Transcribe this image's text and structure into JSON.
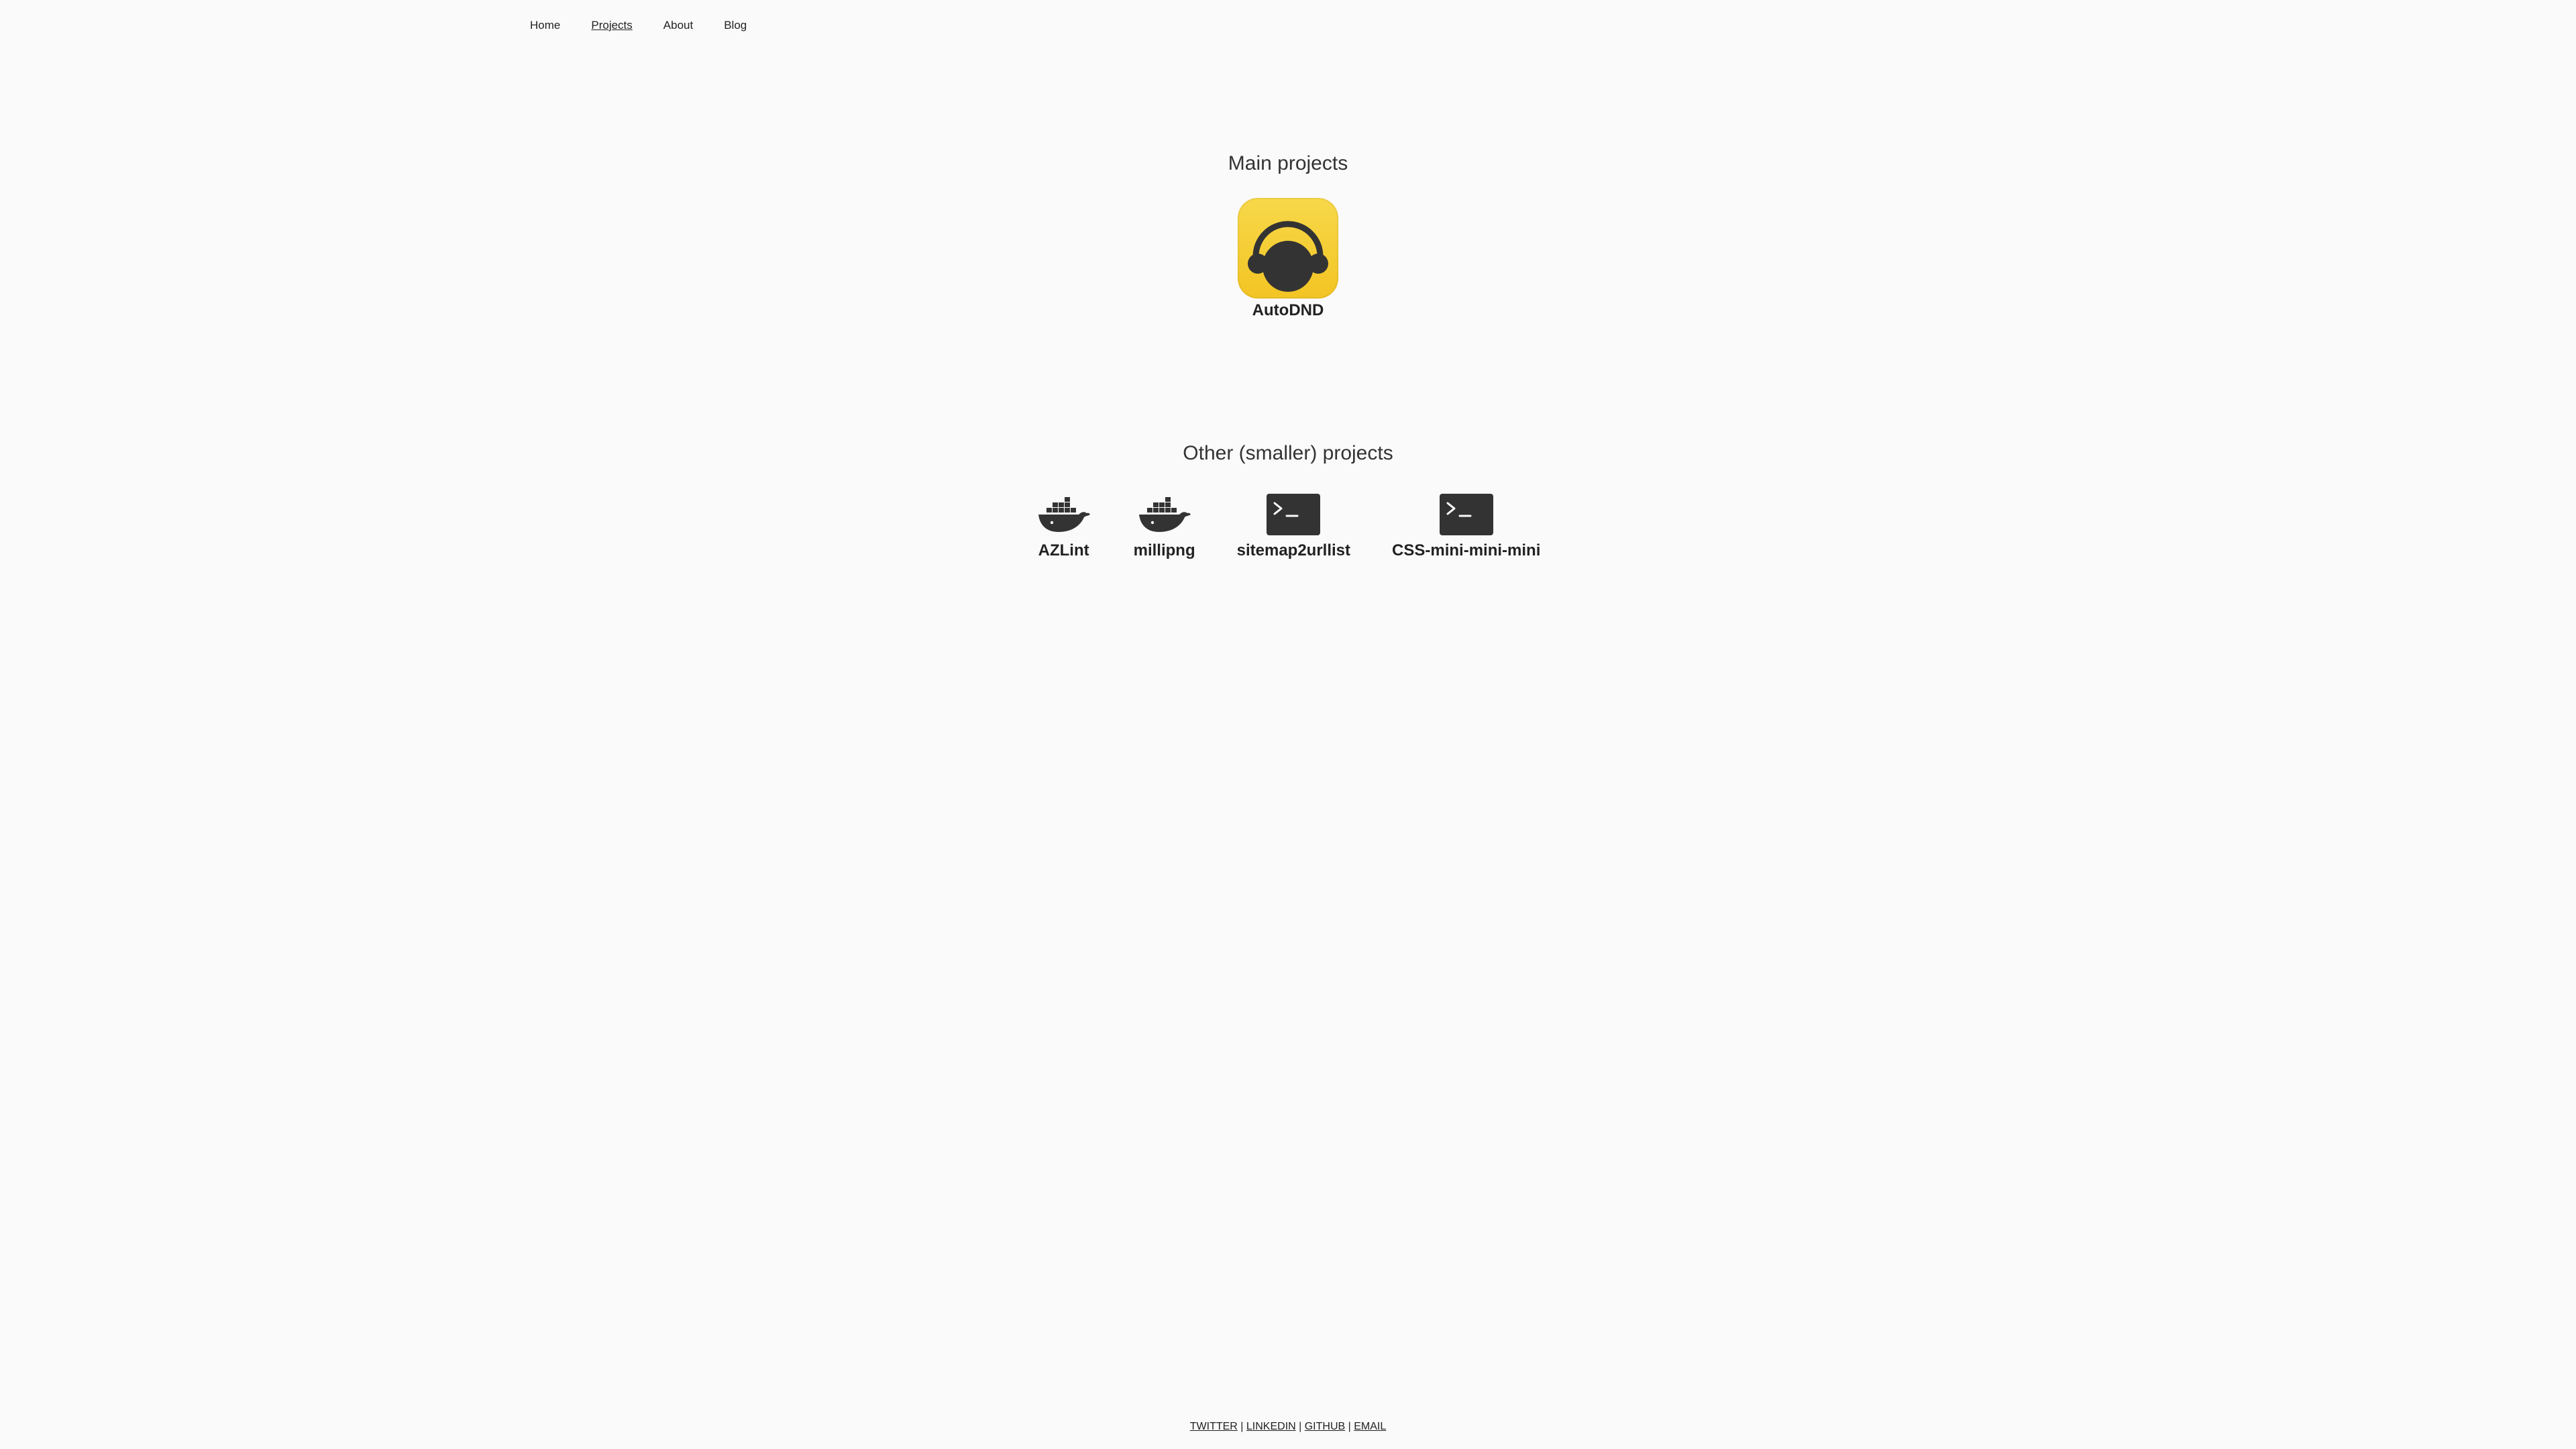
{
  "nav": {
    "items": [
      {
        "label": "Home",
        "active": false
      },
      {
        "label": "Projects",
        "active": true
      },
      {
        "label": "About",
        "active": false
      },
      {
        "label": "Blog",
        "active": false
      }
    ]
  },
  "main_section": {
    "title": "Main projects",
    "projects": [
      {
        "label": "AutoDND",
        "icon": "headphones-icon",
        "icon_bg": "#f5cf36"
      }
    ]
  },
  "other_section": {
    "title": "Other (smaller) projects",
    "projects": [
      {
        "label": "AZLint",
        "icon": "docker-whale-icon"
      },
      {
        "label": "millipng",
        "icon": "docker-whale-icon"
      },
      {
        "label": "sitemap2urllist",
        "icon": "terminal-icon"
      },
      {
        "label": "CSS-mini-mini-mini",
        "icon": "terminal-icon"
      }
    ]
  },
  "footer": {
    "links": [
      "TWITTER",
      "LINKEDIN",
      "GITHUB",
      "EMAIL"
    ],
    "separator": " | "
  },
  "colors": {
    "background": "#fafafa",
    "text": "#222222",
    "icon_dark": "#333333",
    "autodnd_yellow": "#f5cf36"
  }
}
